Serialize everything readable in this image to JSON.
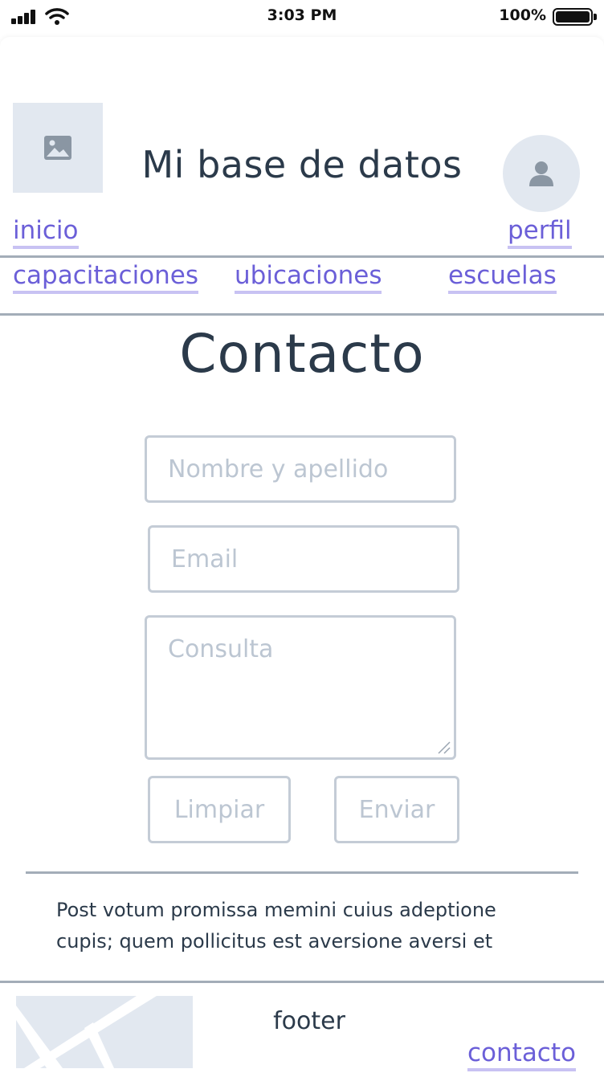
{
  "status": {
    "time": "3:03 PM",
    "battery": "100%",
    "signal_icon": "signal-icon",
    "wifi_icon": "wifi-icon",
    "battery_icon": "battery-icon"
  },
  "header": {
    "title": "Mi base de datos",
    "image_icon": "image-icon",
    "avatar_icon": "user-icon"
  },
  "nav": {
    "inicio": "inicio",
    "perfil": "perfil",
    "capacitaciones": "capacitaciones",
    "ubicaciones": "ubicaciones",
    "escuelas": "escuelas"
  },
  "main": {
    "heading": "Contacto",
    "form": {
      "name_placeholder": "Nombre y apellido",
      "email_placeholder": "Email",
      "message_placeholder": "Consulta",
      "clear_label": "Limpiar",
      "send_label": "Enviar"
    },
    "paragraph": "Post votum promissa memini cuius adeptione cupis; quem pollicitus est aversione aversi et"
  },
  "footer": {
    "label": "footer",
    "contact_link": "contacto"
  },
  "colors": {
    "link": "#6b5fd8",
    "link_underline": "#c8c2f3",
    "placeholder_bg": "#e2e8f0",
    "divider": "#a3adb8",
    "field_border": "#c4ccd6",
    "text": "#2b3a4a"
  }
}
